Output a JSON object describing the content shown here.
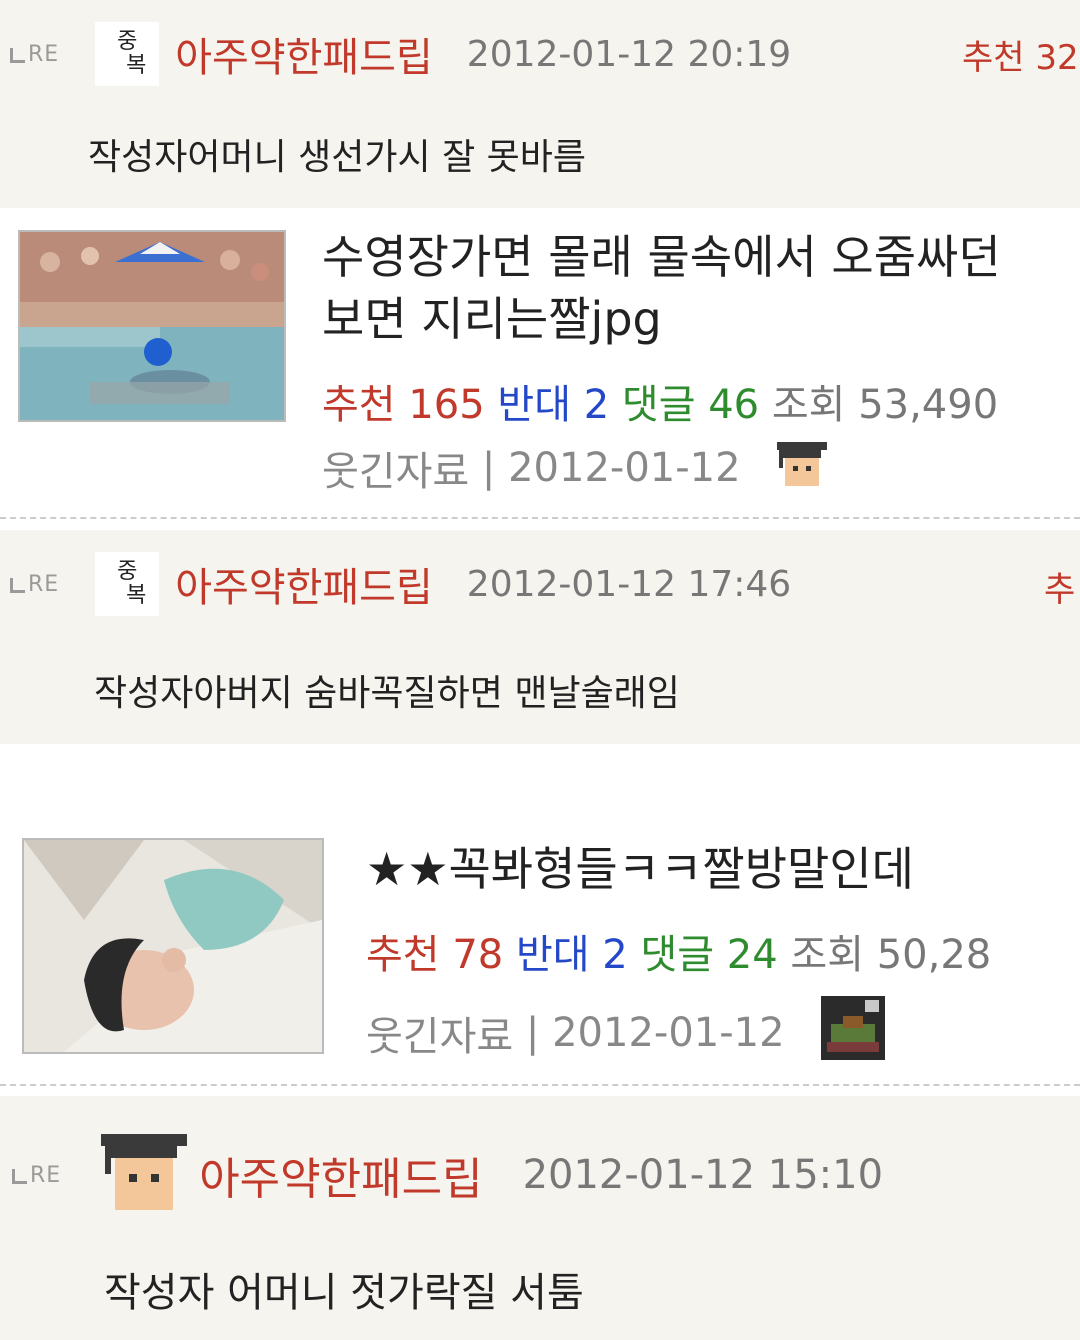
{
  "replies": [
    {
      "re": "RE",
      "badge_top": "중",
      "badge_bottom": "복",
      "nick": "아주약한패드립",
      "time": "2012-01-12 20:19",
      "recommend": "추천 32",
      "body": "작성자어머니 생선가시 잘 못바름"
    },
    {
      "re": "RE",
      "badge_top": "중",
      "badge_bottom": "복",
      "nick": "아주약한패드립",
      "time": "2012-01-12 17:46",
      "recommend": "추",
      "body": "작성자아버지 숨바꼭질하면 맨날술래임"
    },
    {
      "re": "RE",
      "nick": "아주약한패드립",
      "time": "2012-01-12 15:10",
      "body": "작성자 어머니 젓가락질 서툼",
      "icon": "graduate-cap-icon"
    }
  ],
  "posts": [
    {
      "title_line1": "수영장가면 몰래 물속에서 오줌싸던",
      "title_line2": "보면 지리는짤jpg",
      "rec_label": "추천",
      "rec_value": "165",
      "opp_label": "반대",
      "opp_value": "2",
      "cmt_label": "댓글",
      "cmt_value": "46",
      "view_label": "조회",
      "view_value": "53,490",
      "category": "웃긴자료",
      "date": "2012-01-12",
      "thumb": "pool-photo-thumbnail",
      "author_icon": "graduate-cap-icon"
    },
    {
      "title_line1": "★★꼭봐형들ㅋㅋ짤방말인데",
      "rec_label": "추천",
      "rec_value": "78",
      "opp_label": "반대",
      "opp_value": "2",
      "cmt_label": "댓글",
      "cmt_value": "24",
      "view_label": "조회",
      "view_value": "50,28",
      "category": "웃긴자료",
      "date": "2012-01-12",
      "thumb": "woman-photo-thumbnail",
      "author_icon": "character-avatar-icon"
    }
  ],
  "colors": {
    "red": "#c0392b",
    "blue": "#2548c8",
    "green": "#2e8b2e",
    "reply_bg": "#f6f4ee"
  }
}
